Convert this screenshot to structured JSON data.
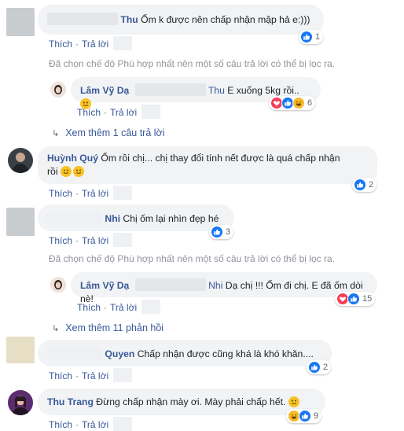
{
  "labels": {
    "like": "Thích",
    "reply": "Trả lời",
    "sep": "·",
    "filter_notice": "Đã chọn chế độ Phù hợp nhất nên một số câu trả lời có thể bị lọc ra."
  },
  "comments": [
    {
      "name": "Thu",
      "text": "Ốm k được nên chấp nhận mập hả e:)))",
      "reactions": "1"
    },
    {
      "name": "Lâm Vỹ Dạ",
      "tag": "Thu",
      "text": "E xuống 5kg rồi..",
      "reactions": "6"
    },
    {
      "more_label": "Xem thêm 1 câu trả lời"
    },
    {
      "name": "Huỳnh Quý",
      "text_line1": "Ốm rồi chị... chị thay đổi tính nết được là quá chấp nhận",
      "text_line2": "rồi",
      "reactions": "2"
    },
    {
      "name": "Nhi",
      "text": "Chị ốm lại nhìn đẹp hé",
      "reactions": "3"
    },
    {
      "name": "Lâm Vỹ Dạ",
      "tag": "Nhi",
      "text": "Dạ chị !!! Ốm đi chị. E đã ốm dòi nè!",
      "reactions": "15"
    },
    {
      "more_label": "Xem thêm 11 phản hồi"
    },
    {
      "name": "Quyen",
      "text": "Chấp nhận được cũng khá là khó khăn....",
      "reactions": "2"
    },
    {
      "name": "Thu Trang",
      "text": "Đừng chấp nhận mày ơi. Mày phải chấp hết.",
      "reactions": "9"
    }
  ],
  "colors": {
    "name_link": "#385898",
    "bubble_bg": "#f2f3f5",
    "like_blue": "#1877f2",
    "love_red": "#f33e58",
    "haha_yellow": "#f7b928"
  },
  "icons": [
    "like-icon",
    "love-icon",
    "haha-icon",
    "smile-emoji",
    "chevron-return-icon"
  ]
}
